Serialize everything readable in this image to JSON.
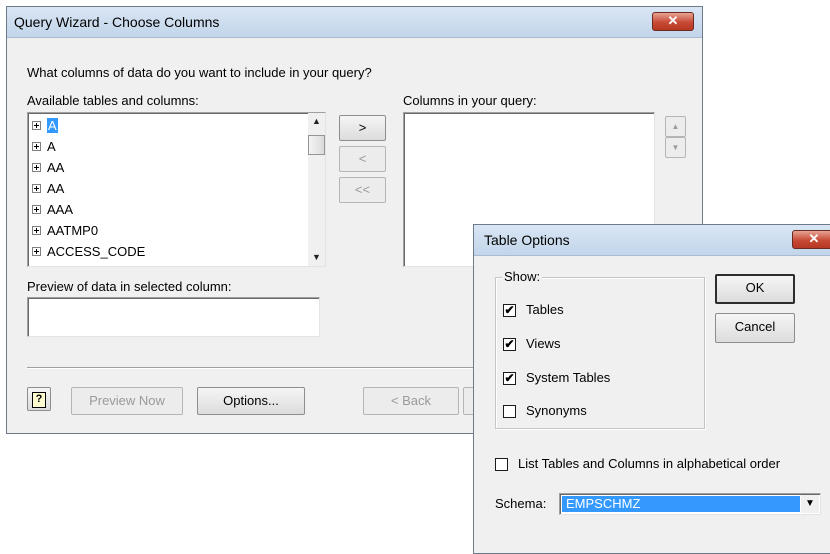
{
  "query_wizard": {
    "title": "Query Wizard - Choose Columns",
    "close_glyph": "✕",
    "prompt": "What columns of data do you want to include in your query?",
    "available_label": "Available tables and columns:",
    "columns_label": "Columns in your query:",
    "tables": [
      "A",
      "A",
      "AA",
      "AA",
      "AAA",
      "AATMP0",
      "ACCESS_CODE"
    ],
    "add_label": ">",
    "remove_label": "<",
    "remove_all_label": "<<",
    "preview_label": "Preview of data in selected column:",
    "help_glyph": "?",
    "preview_now_label": "Preview Now",
    "options_label": "Options...",
    "back_label": "< Back",
    "up_glyph": "▲",
    "down_glyph": "▼"
  },
  "table_options": {
    "title": "Table Options",
    "close_glyph": "✕",
    "show_label": "Show:",
    "show_items": [
      {
        "label": "Tables",
        "checked": true
      },
      {
        "label": "Views",
        "checked": true
      },
      {
        "label": "System Tables",
        "checked": true
      },
      {
        "label": "Synonyms",
        "checked": false
      }
    ],
    "ok_label": "OK",
    "cancel_label": "Cancel",
    "list_alpha_label": "List Tables and Columns in alphabetical order",
    "list_alpha_checked": false,
    "schema_label": "Schema:",
    "schema_value": "EMPSCHMZ",
    "check_glyph": "✔",
    "dropdown_glyph": "▼"
  }
}
